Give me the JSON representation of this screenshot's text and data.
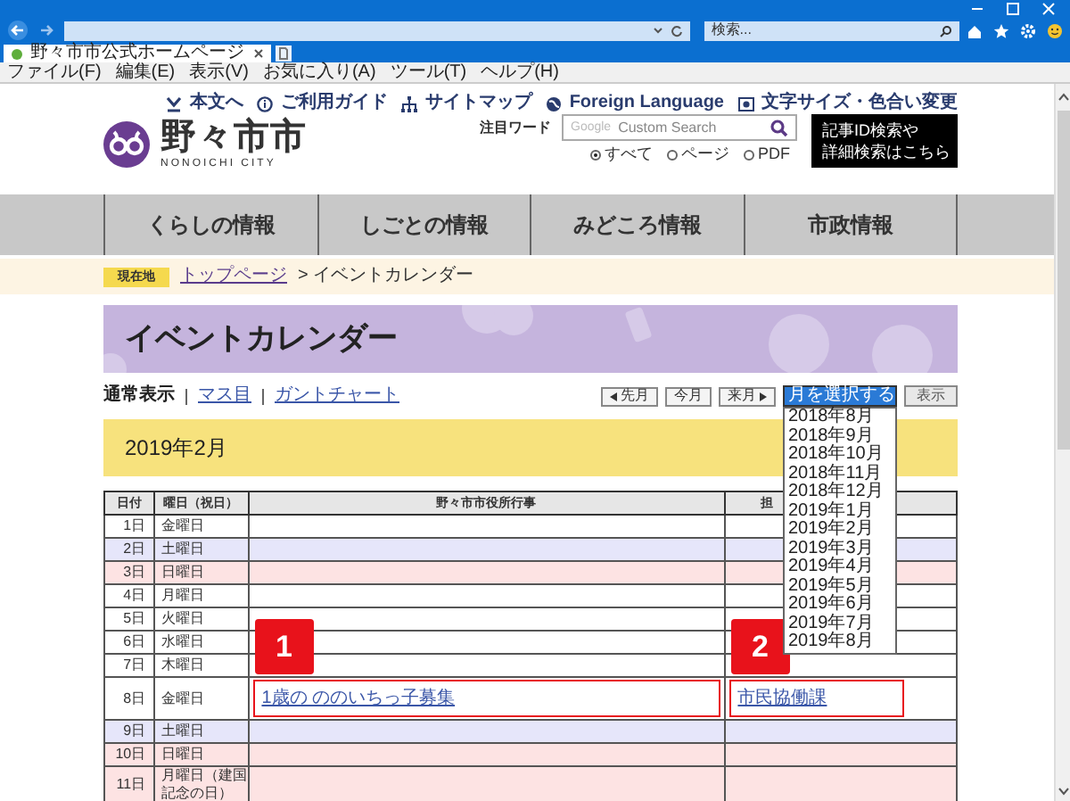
{
  "browser": {
    "tab_title": "野々市市公式ホームページ",
    "search_placeholder": "検索...",
    "menu": [
      "ファイル(F)",
      "編集(E)",
      "表示(V)",
      "お気に入り(A)",
      "ツール(T)",
      "ヘルプ(H)"
    ]
  },
  "header": {
    "logo_name": "野々市市",
    "logo_roman": "NONOICHI CITY",
    "links": [
      {
        "label": "本文へ",
        "kind": "skip"
      },
      {
        "label": "ご利用ガイド",
        "kind": "guide"
      },
      {
        "label": "サイトマップ",
        "kind": "sitemap"
      },
      {
        "label": "Foreign Language",
        "kind": "globe"
      },
      {
        "label": "文字サイズ・色合い変更",
        "kind": "display"
      }
    ],
    "search": {
      "label": "注目ワード",
      "brand": "Google",
      "placeholder": "Custom Search",
      "scopes": [
        {
          "label": "すべて",
          "selected": true
        },
        {
          "label": "ページ",
          "selected": false
        },
        {
          "label": "PDF",
          "selected": false
        }
      ]
    },
    "detail_search": [
      "記事ID検索や",
      "詳細検索はこちら"
    ]
  },
  "nav": [
    "くらしの情報",
    "しごとの情報",
    "みどころ情報",
    "市政情報"
  ],
  "breadcrumb": {
    "badge": "現在地",
    "link": "トップページ",
    "current": "> イベントカレンダー"
  },
  "banner_title": "イベントカレンダー",
  "views": [
    {
      "label": "通常表示",
      "selected": true
    },
    {
      "label": "マス目",
      "selected": false
    },
    {
      "label": "ガントチャート",
      "selected": false
    }
  ],
  "month_buttons": [
    {
      "label": "先月",
      "kind": "prev"
    },
    {
      "label": "今月",
      "kind": "plain"
    },
    {
      "label": "来月",
      "kind": "next"
    }
  ],
  "month_select": {
    "value": "月を選択する",
    "expanded": true,
    "options": [
      "2018年8月",
      "2018年9月",
      "2018年10月",
      "2018年11月",
      "2018年12月",
      "2019年1月",
      "2019年2月",
      "2019年3月",
      "2019年4月",
      "2019年5月",
      "2019年6月",
      "2019年7月",
      "2019年8月"
    ]
  },
  "show_button": "表示",
  "month_title": "2019年2月",
  "table": {
    "columns": [
      "日付",
      "曜日（祝日）",
      "野々市市役所行事",
      "担"
    ],
    "rows": [
      {
        "date": "1日",
        "day": "金曜日",
        "kind": "weekday"
      },
      {
        "date": "2日",
        "day": "土曜日",
        "kind": "saturday"
      },
      {
        "date": "3日",
        "day": "日曜日",
        "kind": "holiday"
      },
      {
        "date": "4日",
        "day": "月曜日",
        "kind": "weekday"
      },
      {
        "date": "5日",
        "day": "火曜日",
        "kind": "weekday"
      },
      {
        "date": "6日",
        "day": "水曜日",
        "kind": "weekday"
      },
      {
        "date": "7日",
        "day": "木曜日",
        "kind": "weekday"
      },
      {
        "date": "8日",
        "day": "金曜日",
        "kind": "weekday",
        "event": "1歳の ののいちっ子募集",
        "department": "市民協働課",
        "event_callout": "1",
        "department_callout": "2"
      },
      {
        "date": "9日",
        "day": "土曜日",
        "kind": "saturday"
      },
      {
        "date": "10日",
        "day": "日曜日",
        "kind": "holiday"
      },
      {
        "date": "11日",
        "day": "月曜日（建国記念の日）",
        "kind": "holiday"
      }
    ]
  }
}
